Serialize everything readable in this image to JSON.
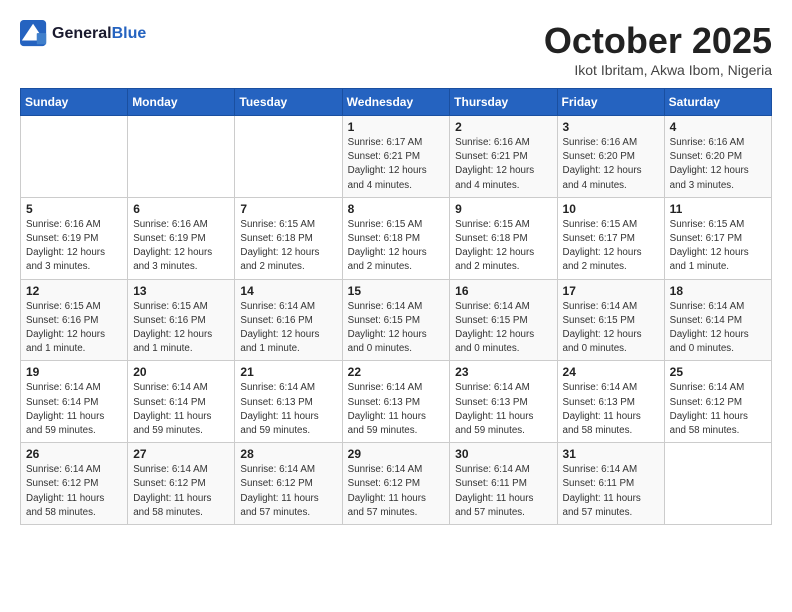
{
  "logo": {
    "line1": "General",
    "line2": "Blue"
  },
  "title": "October 2025",
  "subtitle": "Ikot Ibritam, Akwa Ibom, Nigeria",
  "days_of_week": [
    "Sunday",
    "Monday",
    "Tuesday",
    "Wednesday",
    "Thursday",
    "Friday",
    "Saturday"
  ],
  "weeks": [
    [
      {
        "day": "",
        "detail": ""
      },
      {
        "day": "",
        "detail": ""
      },
      {
        "day": "",
        "detail": ""
      },
      {
        "day": "1",
        "detail": "Sunrise: 6:17 AM\nSunset: 6:21 PM\nDaylight: 12 hours\nand 4 minutes."
      },
      {
        "day": "2",
        "detail": "Sunrise: 6:16 AM\nSunset: 6:21 PM\nDaylight: 12 hours\nand 4 minutes."
      },
      {
        "day": "3",
        "detail": "Sunrise: 6:16 AM\nSunset: 6:20 PM\nDaylight: 12 hours\nand 4 minutes."
      },
      {
        "day": "4",
        "detail": "Sunrise: 6:16 AM\nSunset: 6:20 PM\nDaylight: 12 hours\nand 3 minutes."
      }
    ],
    [
      {
        "day": "5",
        "detail": "Sunrise: 6:16 AM\nSunset: 6:19 PM\nDaylight: 12 hours\nand 3 minutes."
      },
      {
        "day": "6",
        "detail": "Sunrise: 6:16 AM\nSunset: 6:19 PM\nDaylight: 12 hours\nand 3 minutes."
      },
      {
        "day": "7",
        "detail": "Sunrise: 6:15 AM\nSunset: 6:18 PM\nDaylight: 12 hours\nand 2 minutes."
      },
      {
        "day": "8",
        "detail": "Sunrise: 6:15 AM\nSunset: 6:18 PM\nDaylight: 12 hours\nand 2 minutes."
      },
      {
        "day": "9",
        "detail": "Sunrise: 6:15 AM\nSunset: 6:18 PM\nDaylight: 12 hours\nand 2 minutes."
      },
      {
        "day": "10",
        "detail": "Sunrise: 6:15 AM\nSunset: 6:17 PM\nDaylight: 12 hours\nand 2 minutes."
      },
      {
        "day": "11",
        "detail": "Sunrise: 6:15 AM\nSunset: 6:17 PM\nDaylight: 12 hours\nand 1 minute."
      }
    ],
    [
      {
        "day": "12",
        "detail": "Sunrise: 6:15 AM\nSunset: 6:16 PM\nDaylight: 12 hours\nand 1 minute."
      },
      {
        "day": "13",
        "detail": "Sunrise: 6:15 AM\nSunset: 6:16 PM\nDaylight: 12 hours\nand 1 minute."
      },
      {
        "day": "14",
        "detail": "Sunrise: 6:14 AM\nSunset: 6:16 PM\nDaylight: 12 hours\nand 1 minute."
      },
      {
        "day": "15",
        "detail": "Sunrise: 6:14 AM\nSunset: 6:15 PM\nDaylight: 12 hours\nand 0 minutes."
      },
      {
        "day": "16",
        "detail": "Sunrise: 6:14 AM\nSunset: 6:15 PM\nDaylight: 12 hours\nand 0 minutes."
      },
      {
        "day": "17",
        "detail": "Sunrise: 6:14 AM\nSunset: 6:15 PM\nDaylight: 12 hours\nand 0 minutes."
      },
      {
        "day": "18",
        "detail": "Sunrise: 6:14 AM\nSunset: 6:14 PM\nDaylight: 12 hours\nand 0 minutes."
      }
    ],
    [
      {
        "day": "19",
        "detail": "Sunrise: 6:14 AM\nSunset: 6:14 PM\nDaylight: 11 hours\nand 59 minutes."
      },
      {
        "day": "20",
        "detail": "Sunrise: 6:14 AM\nSunset: 6:14 PM\nDaylight: 11 hours\nand 59 minutes."
      },
      {
        "day": "21",
        "detail": "Sunrise: 6:14 AM\nSunset: 6:13 PM\nDaylight: 11 hours\nand 59 minutes."
      },
      {
        "day": "22",
        "detail": "Sunrise: 6:14 AM\nSunset: 6:13 PM\nDaylight: 11 hours\nand 59 minutes."
      },
      {
        "day": "23",
        "detail": "Sunrise: 6:14 AM\nSunset: 6:13 PM\nDaylight: 11 hours\nand 59 minutes."
      },
      {
        "day": "24",
        "detail": "Sunrise: 6:14 AM\nSunset: 6:13 PM\nDaylight: 11 hours\nand 58 minutes."
      },
      {
        "day": "25",
        "detail": "Sunrise: 6:14 AM\nSunset: 6:12 PM\nDaylight: 11 hours\nand 58 minutes."
      }
    ],
    [
      {
        "day": "26",
        "detail": "Sunrise: 6:14 AM\nSunset: 6:12 PM\nDaylight: 11 hours\nand 58 minutes."
      },
      {
        "day": "27",
        "detail": "Sunrise: 6:14 AM\nSunset: 6:12 PM\nDaylight: 11 hours\nand 58 minutes."
      },
      {
        "day": "28",
        "detail": "Sunrise: 6:14 AM\nSunset: 6:12 PM\nDaylight: 11 hours\nand 57 minutes."
      },
      {
        "day": "29",
        "detail": "Sunrise: 6:14 AM\nSunset: 6:12 PM\nDaylight: 11 hours\nand 57 minutes."
      },
      {
        "day": "30",
        "detail": "Sunrise: 6:14 AM\nSunset: 6:11 PM\nDaylight: 11 hours\nand 57 minutes."
      },
      {
        "day": "31",
        "detail": "Sunrise: 6:14 AM\nSunset: 6:11 PM\nDaylight: 11 hours\nand 57 minutes."
      },
      {
        "day": "",
        "detail": ""
      }
    ]
  ]
}
